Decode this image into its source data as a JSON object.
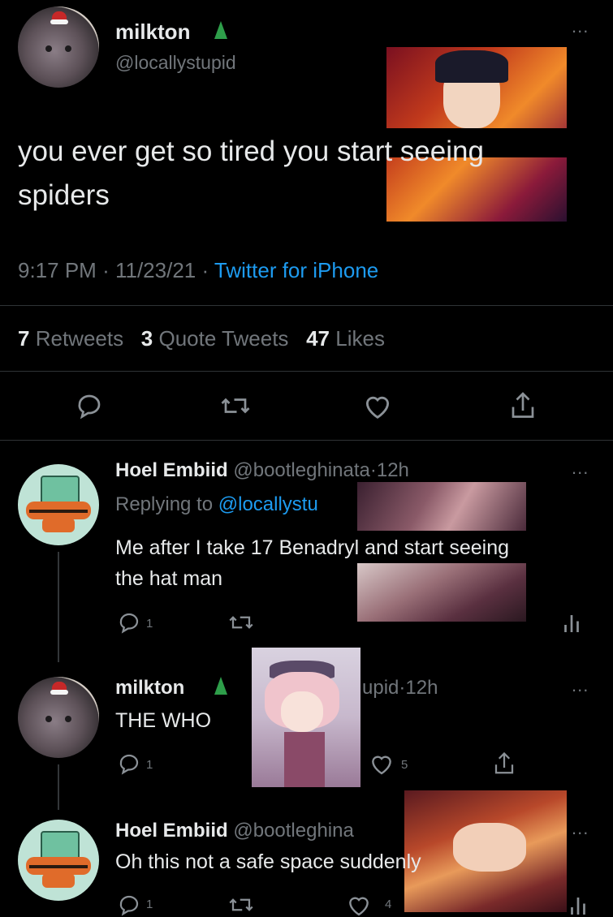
{
  "main_tweet": {
    "display_name": "milkton",
    "handle": "@locallystupid",
    "text_line1": "you ever get so tired you start seeing",
    "text_line2": "spiders",
    "time": "9:17 PM",
    "date": "11/23/21",
    "source": "Twitter for iPhone",
    "sep": "·",
    "stats": {
      "retweets_count": "7",
      "retweets_label": "Retweets",
      "quotes_count": "3",
      "quotes_label": "Quote Tweets",
      "likes_count": "47",
      "likes_label": "Likes"
    },
    "more": "..."
  },
  "replies": [
    {
      "display_name": "Hoel Embiid",
      "handle": "@bootleghinata",
      "time": "12h",
      "replying_prefix": "Replying to",
      "replying_handle": "@locallystu",
      "text_line1": "Me after I take 17 Benadryl and start seeing",
      "text_line2": "the hat man",
      "reply_count": "1",
      "more": "..."
    },
    {
      "display_name": "milkton",
      "handle_visible": "upid",
      "time": "12h",
      "text": "THE WHO",
      "reply_count": "1",
      "like_count": "5",
      "more": "..."
    },
    {
      "display_name": "Hoel Embiid",
      "handle": "@bootleghina",
      "text": "Oh this not a safe space suddenly",
      "reply_count": "1",
      "like_count": "4",
      "more": "..."
    }
  ],
  "colors": {
    "background": "#000000",
    "text": "#e7e9ea",
    "muted": "#71767b",
    "link": "#1d9bf0",
    "divider": "#2f3336"
  },
  "icons": [
    "reply-icon",
    "retweet-icon",
    "like-icon",
    "share-icon",
    "analytics-icon",
    "christmas-tree-icon",
    "more-icon"
  ]
}
